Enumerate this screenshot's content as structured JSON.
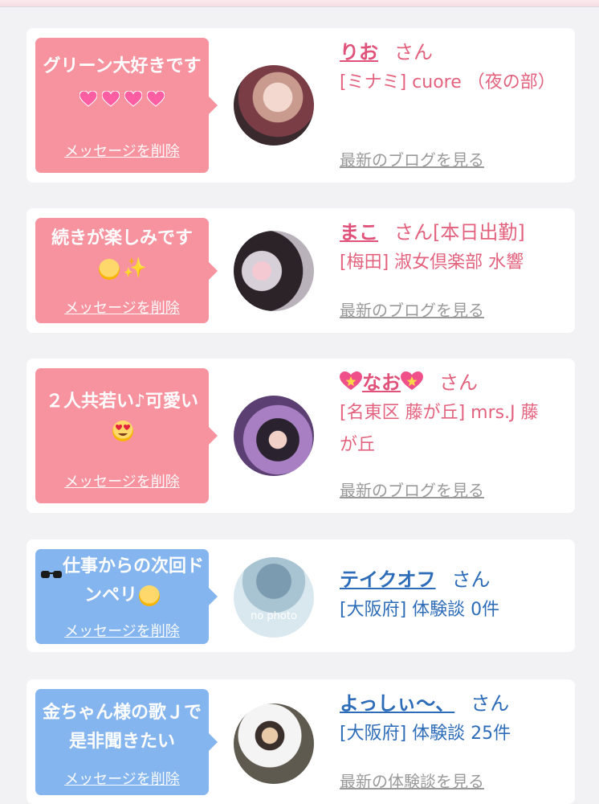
{
  "items": [
    {
      "message": "グリーン大好きです",
      "message_emoji": [
        "growing-heart",
        "growing-heart",
        "growing-heart",
        "growing-heart"
      ],
      "delete_label": "メッセージを削除",
      "name": "りお",
      "honorific": "さん",
      "store": "[ミナミ] cuore （夜の部）",
      "link": "最新のブログを見る"
    },
    {
      "message": "続きが楽しみです",
      "message_emoji": [
        "smiling-face",
        "sparkles"
      ],
      "delete_label": "メッセージを削除",
      "name": "まこ",
      "honorific": "さん[本日出勤]",
      "store": "[梅田] 淑女倶楽部 水響",
      "link": "最新のブログを見る"
    },
    {
      "message": "２人共若い♪可愛い",
      "message_emoji": [
        "heart-eyes-face"
      ],
      "delete_label": "メッセージを削除",
      "name": "なお",
      "name_emoji": [
        "sparkling-heart",
        "sparkling-heart"
      ],
      "honorific": "さん",
      "store": "[名東区 藤が丘] mrs.J 藤が丘",
      "link": "最新のブログを見る"
    },
    {
      "message": "仕事からの次回ドンペリ",
      "message_emoji": [
        "sunglasses",
        "smiling-face"
      ],
      "delete_label": "メッセージを削除",
      "avatar_text": "no photo",
      "name": "テイクオフ",
      "honorific": "さん",
      "store": "[大阪府] 体験談 0件",
      "link": ""
    },
    {
      "message": "金ちゃん様の歌Ｊで是非聞きたい",
      "message_emoji": [],
      "delete_label": "メッセージを削除",
      "name": "よっしぃ〜、",
      "honorific": "さん",
      "store": "[大阪府] 体験談 25件",
      "link": "最新の体験談を見る"
    }
  ]
}
